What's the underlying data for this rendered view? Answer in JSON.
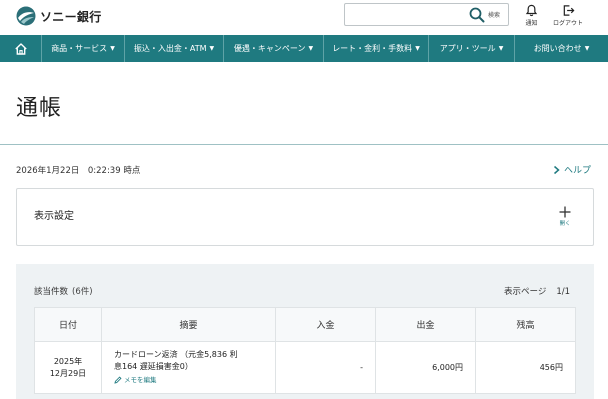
{
  "header": {
    "logo_text": "ソニー銀行",
    "search": {
      "value": "",
      "placeholder": "",
      "button_label": "検索"
    },
    "notification_label": "通知",
    "logout_label": "ログアウト"
  },
  "nav": {
    "items": [
      {
        "label": "商品・サービス"
      },
      {
        "label": "振込・入出金・ATM"
      },
      {
        "label": "優遇・キャンペーン"
      },
      {
        "label": "レート・金利・手数料"
      },
      {
        "label": "アプリ・ツール"
      },
      {
        "label": "お問い合わせ"
      }
    ]
  },
  "page": {
    "title": "通帳",
    "timestamp": "2026年1月22日　0:22:39 時点",
    "help_label": "ヘルプ"
  },
  "settings": {
    "title": "表示設定",
    "toggle_label": "開く"
  },
  "results": {
    "count_label": "該当件数",
    "count_value": "(6件)",
    "page_label": "表示ページ",
    "page_value": "1/1",
    "columns": [
      "日付",
      "摘要",
      "入金",
      "出金",
      "残高"
    ],
    "rows": [
      {
        "date_line1": "2025年",
        "date_line2": "12月29日",
        "desc_line1": "カードローン返済 （元金5,836 利",
        "desc_line2": "息164 遅延損害金0）",
        "memo_label": "メモを編集",
        "deposit": "-",
        "withdrawal": "6,000円",
        "balance": "456円"
      }
    ]
  },
  "colors": {
    "brand_teal": "#1f7a80",
    "nav_divider": "#5fa3a7",
    "panel_bg": "#eef2f4"
  },
  "icons": [
    "sony-bank-logo-icon",
    "search-icon",
    "bell-icon",
    "logout-icon",
    "home-icon",
    "chevron-right-icon",
    "plus-icon",
    "pencil-icon"
  ]
}
